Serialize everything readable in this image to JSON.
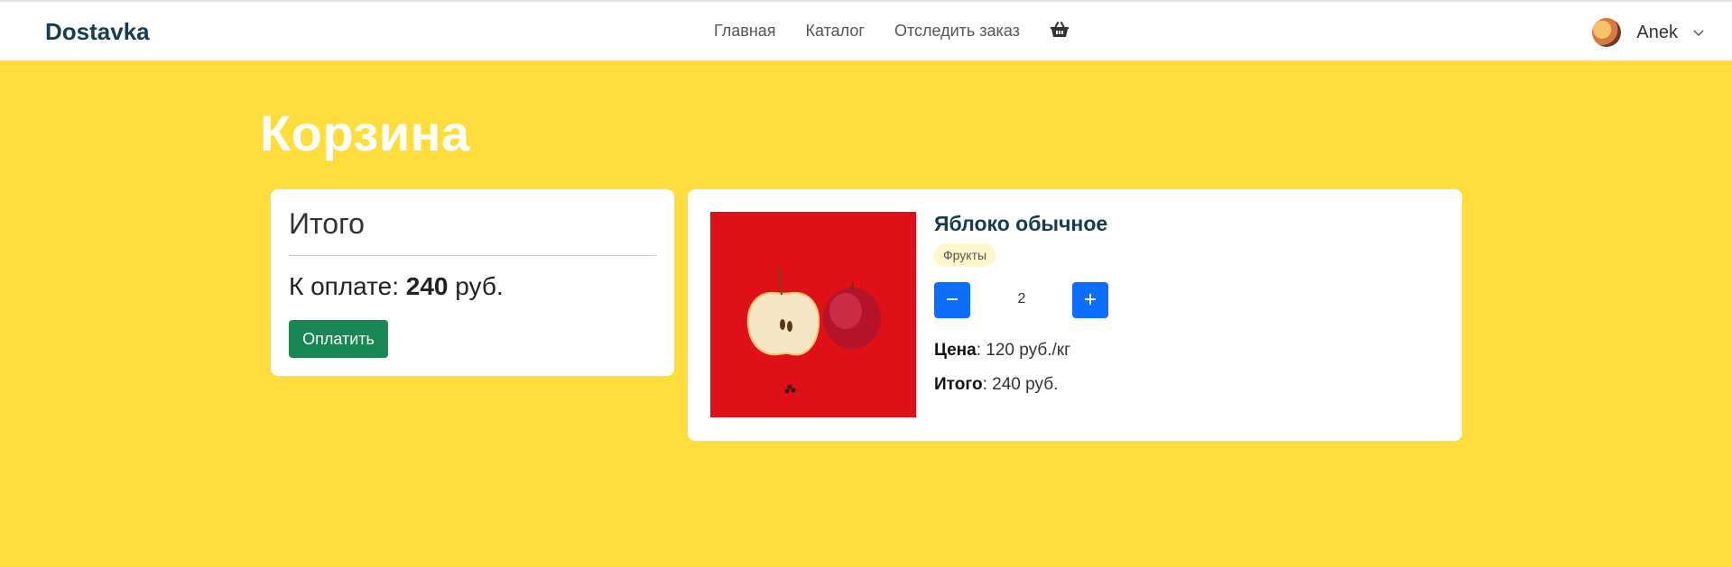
{
  "navbar": {
    "brand": "Dostavka",
    "links": [
      "Главная",
      "Каталог",
      "Отследить заказ"
    ],
    "cart_icon": "basket-icon",
    "user": {
      "name": "Anek",
      "avatar_icon": "user-avatar",
      "menu_icon": "chevron-down-icon"
    }
  },
  "page": {
    "title": "Корзина"
  },
  "summary": {
    "title": "Итого",
    "pay_label": "К оплате:",
    "pay_amount": "240",
    "pay_currency": "руб.",
    "pay_button": "Оплатить"
  },
  "cart_items": [
    {
      "name": "Яблоко обычное",
      "tag": "Фрукты",
      "quantity": "2",
      "minus_icon": "minus-icon",
      "plus_icon": "plus-icon",
      "price_label": "Цена",
      "price_value": "120 руб./кг",
      "total_label": "Итого",
      "total_value": "240 руб."
    }
  ],
  "colors": {
    "background": "#ffdd3c",
    "brand": "#143d52",
    "pay_button": "#198754",
    "qty_button": "#0d6efd",
    "tag_bg": "#fff7c9"
  }
}
